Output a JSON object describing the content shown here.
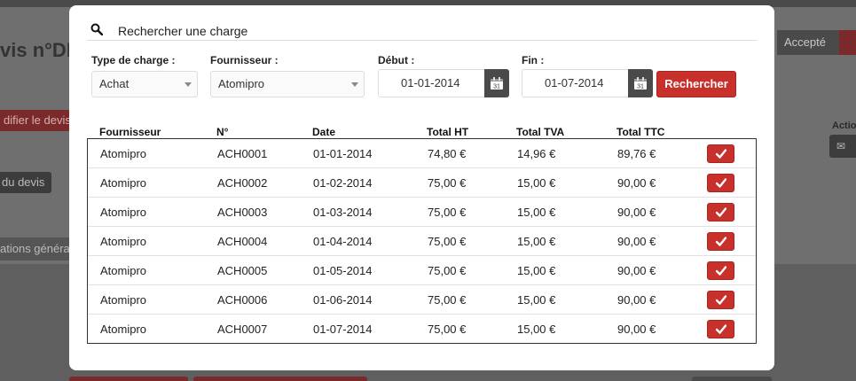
{
  "background": {
    "title_fragment": "vis n°DE",
    "accepted_label": "Accepté",
    "modify_button": "difier le devis",
    "devis_button": "du devis",
    "tab_fragment": "ations généra",
    "actions_fragment": "Actio"
  },
  "modal": {
    "title": "Rechercher une charge",
    "filters": {
      "type_label": "Type de charge :",
      "type_value": "Achat",
      "supplier_label": "Fournisseur :",
      "supplier_value": "Atomipro",
      "start_label": "Début :",
      "start_value": "01-01-2014",
      "end_label": "Fin :",
      "end_value": "01-07-2014",
      "search_button": "Rechercher"
    },
    "table": {
      "headers": [
        "Fournisseur",
        "N°",
        "Date",
        "Total HT",
        "Total TVA",
        "Total TTC"
      ],
      "rows": [
        {
          "supplier": "Atomipro",
          "number": "ACH0001",
          "date": "01-01-2014",
          "ht": "74,80 €",
          "tva": "14,96 €",
          "ttc": "89,76 €"
        },
        {
          "supplier": "Atomipro",
          "number": "ACH0002",
          "date": "01-02-2014",
          "ht": "75,00 €",
          "tva": "15,00 €",
          "ttc": "90,00 €"
        },
        {
          "supplier": "Atomipro",
          "number": "ACH0003",
          "date": "01-03-2014",
          "ht": "75,00 €",
          "tva": "15,00 €",
          "ttc": "90,00 €"
        },
        {
          "supplier": "Atomipro",
          "number": "ACH0004",
          "date": "01-04-2014",
          "ht": "75,00 €",
          "tva": "15,00 €",
          "ttc": "90,00 €"
        },
        {
          "supplier": "Atomipro",
          "number": "ACH0005",
          "date": "01-05-2014",
          "ht": "75,00 €",
          "tva": "15,00 €",
          "ttc": "90,00 €"
        },
        {
          "supplier": "Atomipro",
          "number": "ACH0006",
          "date": "01-06-2014",
          "ht": "75,00 €",
          "tva": "15,00 €",
          "ttc": "90,00 €"
        },
        {
          "supplier": "Atomipro",
          "number": "ACH0007",
          "date": "01-07-2014",
          "ht": "75,00 €",
          "tva": "15,00 €",
          "ttc": "90,00 €"
        }
      ]
    }
  },
  "colors": {
    "accent_red": "#c8302b",
    "dark_button": "#4a4a4a"
  },
  "icons": {
    "search": "search-icon",
    "calendar": "calendar-icon",
    "select_row": "check-icon"
  }
}
